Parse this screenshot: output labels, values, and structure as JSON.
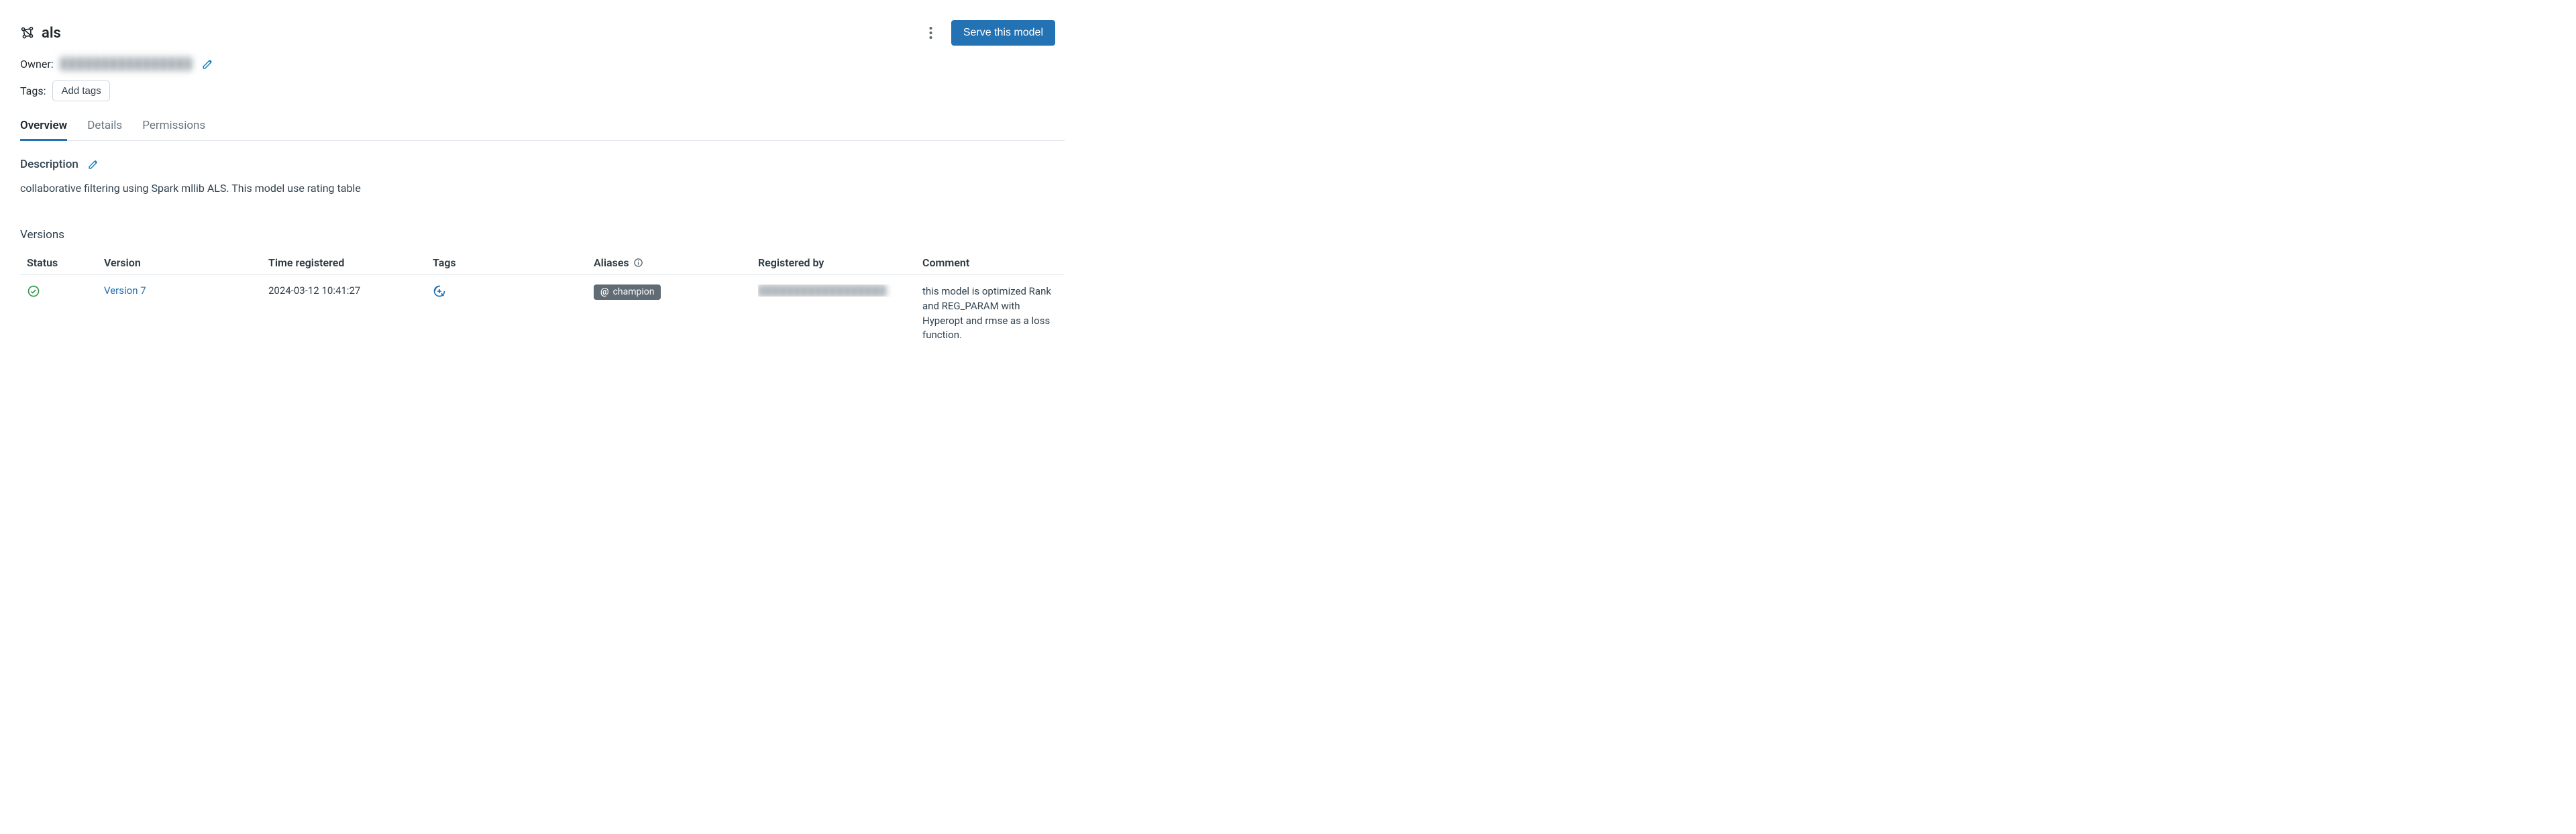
{
  "header": {
    "title": "als",
    "serve_button_label": "Serve this model"
  },
  "meta": {
    "owner_label": "Owner:",
    "owner_value": "████████████████",
    "tags_label": "Tags:",
    "add_tags_button_label": "Add tags"
  },
  "tabs": {
    "overview": "Overview",
    "details": "Details",
    "permissions": "Permissions"
  },
  "description": {
    "heading": "Description",
    "text": "collaborative filtering using Spark mllib ALS. This model use rating table"
  },
  "versions": {
    "heading": "Versions",
    "columns": {
      "status": "Status",
      "version": "Version",
      "time_registered": "Time registered",
      "tags": "Tags",
      "aliases": "Aliases",
      "registered_by": "Registered by",
      "comment": "Comment"
    },
    "rows": [
      {
        "status": "ready",
        "version_label": "Version 7",
        "time_registered": "2024-03-12 10:41:27",
        "alias": "champion",
        "registered_by": "██████████████████",
        "comment": "this model is optimized Rank and REG_PARAM with Hyperopt and rmse as a loss function."
      }
    ]
  }
}
